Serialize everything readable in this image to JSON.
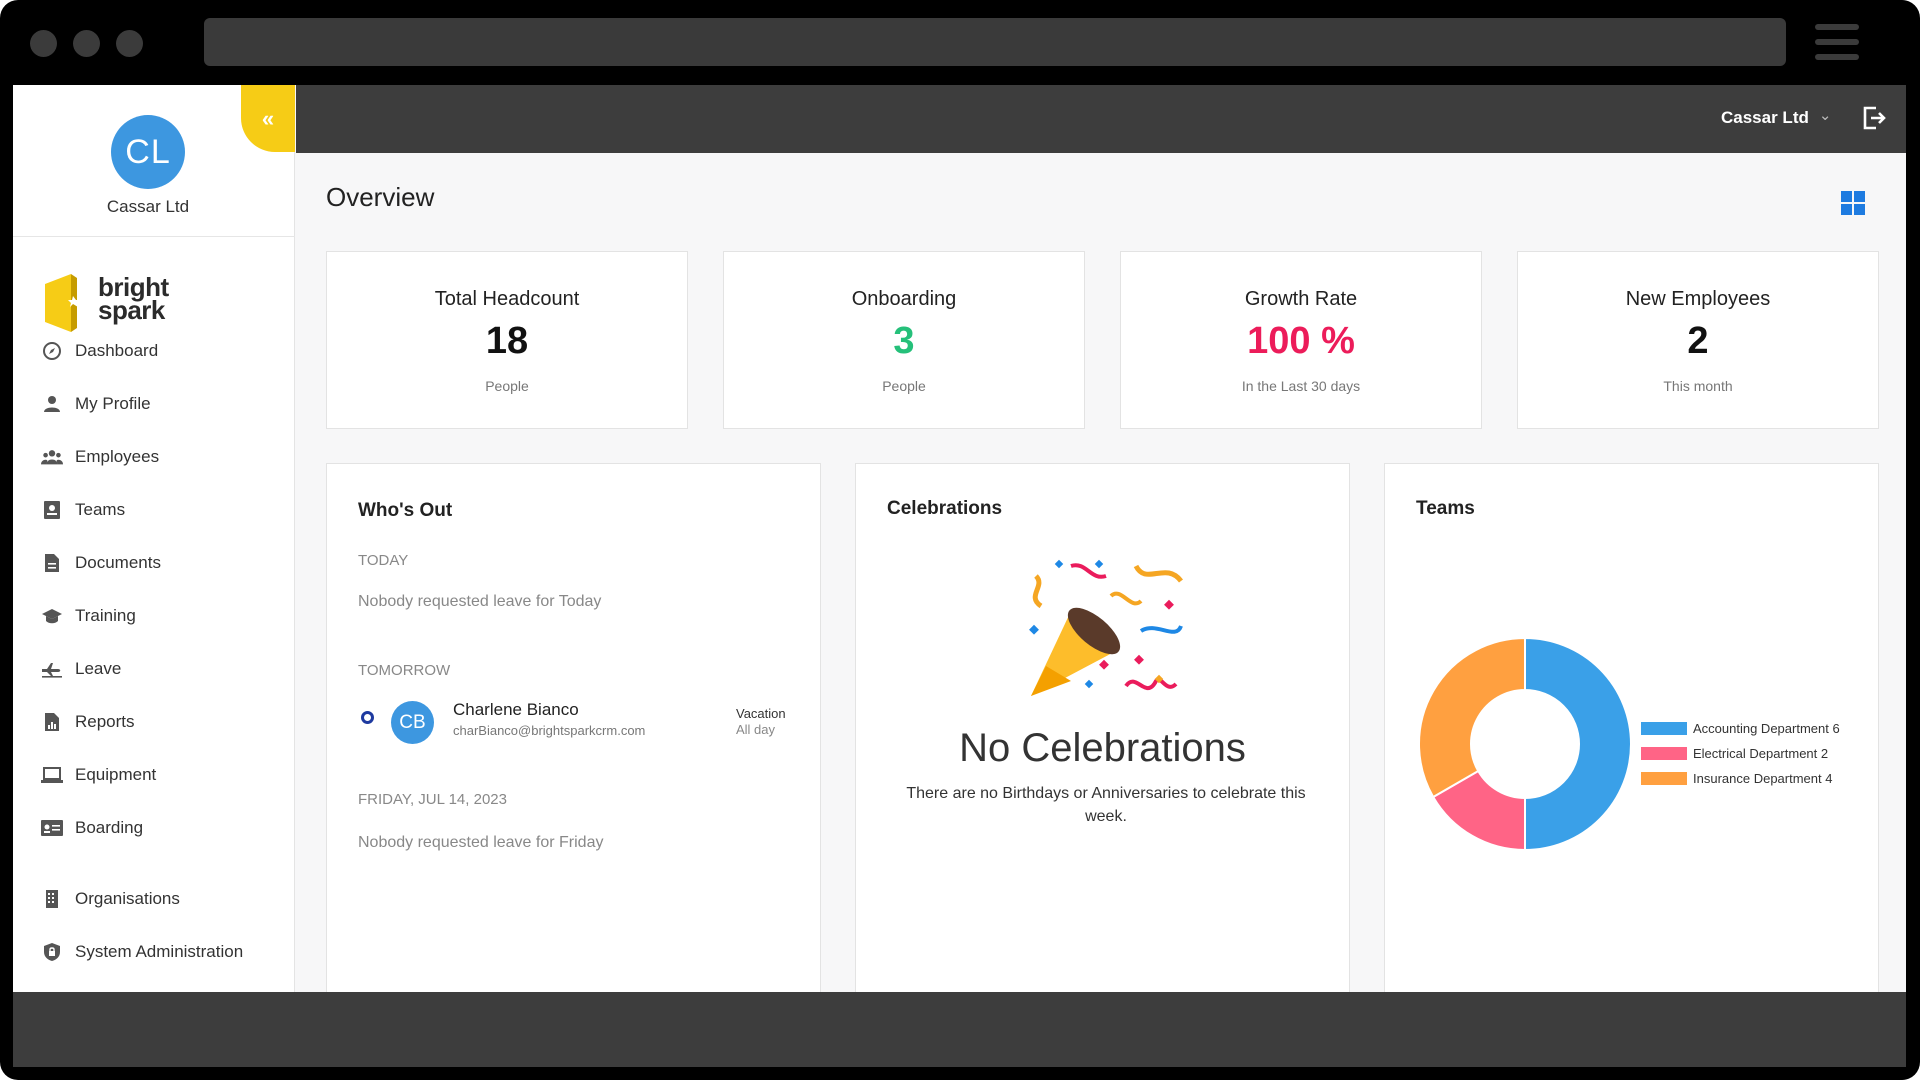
{
  "org": {
    "initials": "CL",
    "name": "Cassar Ltd"
  },
  "logo": {
    "line1": "bright",
    "line2": "spark"
  },
  "nav": [
    {
      "label": "Dashboard",
      "icon": "compass-icon"
    },
    {
      "label": "My Profile",
      "icon": "user-icon"
    },
    {
      "label": "Employees",
      "icon": "users-icon"
    },
    {
      "label": "Teams",
      "icon": "id-card-icon"
    },
    {
      "label": "Documents",
      "icon": "document-icon"
    },
    {
      "label": "Training",
      "icon": "graduation-cap-icon"
    },
    {
      "label": "Leave",
      "icon": "plane-icon"
    },
    {
      "label": "Reports",
      "icon": "report-icon"
    },
    {
      "label": "Equipment",
      "icon": "laptop-icon"
    },
    {
      "label": "Boarding",
      "icon": "badge-icon"
    },
    {
      "label": "Organisations",
      "icon": "building-icon"
    },
    {
      "label": "System Administration",
      "icon": "shield-icon"
    }
  ],
  "collapse": {
    "glyph": "«"
  },
  "topbar": {
    "company": "Cassar Ltd",
    "chevron": "⌄"
  },
  "page": {
    "title": "Overview"
  },
  "stats": [
    {
      "title": "Total Headcount",
      "value": "18",
      "sub": "People",
      "color": "#111111"
    },
    {
      "title": "Onboarding",
      "value": "3",
      "sub": "People",
      "color": "#25c07a"
    },
    {
      "title": "Growth Rate",
      "value": "100 %",
      "sub": "In the Last 30 days",
      "color": "#ec1c5a"
    },
    {
      "title": "New Employees",
      "value": "2",
      "sub": "This month",
      "color": "#111111"
    }
  ],
  "whos_out": {
    "title": "Who's Out",
    "today_label": "TODAY",
    "today_empty": "Nobody requested leave for Today",
    "tomorrow_label": "TOMORROW",
    "employee": {
      "initials": "CB",
      "name": "Charlene Bianco",
      "email": "charBianco@brightsparkcrm.com",
      "leave_type": "Vacation",
      "duration": "All day"
    },
    "friday_label": "FRIDAY, JUL 14, 2023",
    "friday_empty": "Nobody requested leave for Friday"
  },
  "celebrations": {
    "title": "Celebrations",
    "heading": "No Celebrations",
    "text": "There are no Birthdays or Anniversaries to celebrate this week."
  },
  "teams": {
    "title": "Teams",
    "chart_data": {
      "type": "pie",
      "categories": [
        "Accounting Department 6",
        "Electrical Department 2",
        "Insurance Department 4"
      ],
      "values": [
        6,
        2,
        4
      ],
      "colors": [
        "#3aa0e8",
        "#ff6486",
        "#ffa040"
      ],
      "donut": true,
      "legend_position": "right"
    }
  }
}
